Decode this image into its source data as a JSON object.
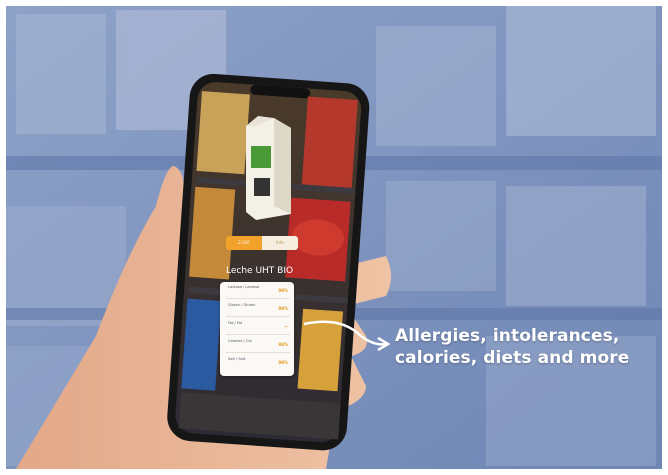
{
  "callout": {
    "line1": "Allergies, intolerances,",
    "line2": "calories, diets and more"
  },
  "app": {
    "tab_a": "2,51€",
    "tab_b": "Info",
    "product_name": "Leche UHT BIO",
    "rows": [
      {
        "label": "Lactosa / Lactose",
        "value": "98%"
      },
      {
        "label": "Gluten / Gluten",
        "value": "98%"
      },
      {
        "label": "Fat / Fat",
        "value": "—"
      },
      {
        "label": "Calories / Cal",
        "value": "98%"
      },
      {
        "label": "Salt / Salt",
        "value": "98%"
      }
    ]
  },
  "colors": {
    "accent": "#f2a12a",
    "shelf_blue": "#7d93bd",
    "phone_body": "#1a1a1a"
  },
  "icons": [
    "milk-carton-icon",
    "arrow-curve-icon"
  ]
}
